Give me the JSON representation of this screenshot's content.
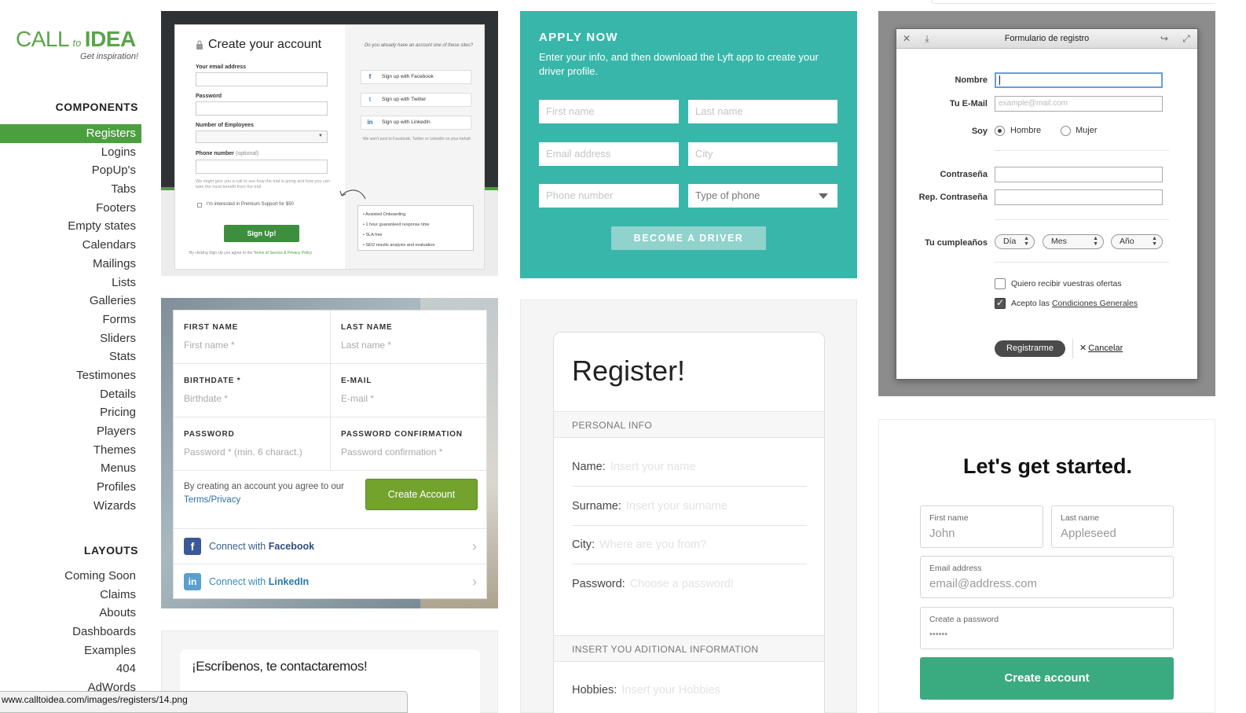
{
  "sidebar": {
    "logo": {
      "call": "CALL",
      "to": "to",
      "idea": "IDEA",
      "tagline": "Get inspiration!"
    },
    "components_title": "COMPONENTS",
    "components": [
      "Registers",
      "Logins",
      "PopUp's",
      "Tabs",
      "Footers",
      "Empty states",
      "Calendars",
      "Mailings",
      "Lists",
      "Galleries",
      "Forms",
      "Sliders",
      "Stats",
      "Testimones",
      "Details",
      "Pricing",
      "Players",
      "Themes",
      "Menus",
      "Profiles",
      "Wizards"
    ],
    "layouts_title": "LAYOUTS",
    "layouts": [
      "Coming Soon",
      "Claims",
      "Abouts",
      "Dashboards",
      "Examples",
      "404",
      "AdWords"
    ]
  },
  "statusbar": {
    "url": "www.calltoidea.com/images/registers/14.png"
  },
  "card1": {
    "title": "Create your account",
    "email_label": "Your email address",
    "password_label": "Password",
    "employees_label": "Number of Employees",
    "phone_label": "Phone number",
    "phone_optional": "(optional)",
    "phone_note": "We might give you a call to see how the trial is going and how you can take the most benefit from the trial",
    "premium_label": "I'm interested in Premium Support for $50",
    "signup_button": "Sign Up!",
    "terms_prefix": "By clicking Sign Up you agree to the",
    "terms_link": "Terms of Service & Privacy Policy",
    "already": "Do you already have an account one of these sites?",
    "social": [
      {
        "label": "Sign up with Facebook",
        "icon": "f",
        "color": "#3b5998"
      },
      {
        "label": "Sign up with Twitter",
        "icon": "t",
        "color": "#4aa3df"
      },
      {
        "label": "Sign up with LinkedIn",
        "icon": "in",
        "color": "#2a6fa8"
      }
    ],
    "social_note": "We won't post to Facebook, Twitter or LinkedIn on your behalf.",
    "benefits": [
      "Assisted Onboarding",
      "1 hour guaranteed response time",
      "SLA free",
      "SEO results analysis and evaluation"
    ]
  },
  "card2": {
    "title": "APPLY NOW",
    "description": "Enter your info, and then download the Lyft app to create your driver profile.",
    "first_name": "First name",
    "last_name": "Last name",
    "email": "Email address",
    "city": "City",
    "phone": "Phone number",
    "phone_type": "Type of phone",
    "button": "BECOME A DRIVER"
  },
  "card3": {
    "window_title": "Formulario de registro",
    "nombre_label": "Nombre",
    "email_label": "Tu E-Mail",
    "email_placeholder": "example@mail.com",
    "soy_label": "Soy",
    "hombre": "Hombre",
    "mujer": "Mujer",
    "password_label": "Contraseña",
    "password_repeat_label": "Rep. Contraseña",
    "birthday_label": "Tu cumpleaños",
    "day": "Día",
    "month": "Mes",
    "year": "Año",
    "offers_label": "Quiero recibir vuestras ofertas",
    "accept_prefix": "Acepto las",
    "accept_link": "Condiciones Generales",
    "register_button": "Registrarme",
    "cancel": "Cancelar"
  },
  "card4": {
    "fields": [
      {
        "label": "FIRST NAME",
        "placeholder": "First name *"
      },
      {
        "label": "LAST NAME",
        "placeholder": "Last name *"
      },
      {
        "label": "BIRTHDATE *",
        "placeholder": "Birthdate *"
      },
      {
        "label": "E-MAIL",
        "placeholder": "E-mail *"
      },
      {
        "label": "PASSWORD",
        "placeholder": "Password * (min. 6 charact.)"
      },
      {
        "label": "PASSWORD CONFIRMATION",
        "placeholder": "Password confirmation *"
      }
    ],
    "agree_prefix": "By creating an account you agree to our",
    "agree_link": "Terms/Privacy",
    "create_button": "Create Account",
    "facebook_prefix": "Connect with",
    "facebook_brand": "Facebook",
    "linkedin_prefix": "Connect with",
    "linkedin_brand": "LinkedIn"
  },
  "card5": {
    "title": "Register!",
    "personal_info": "PERSONAL INFO",
    "rows": [
      {
        "label": "Name:",
        "placeholder": "Insert your name"
      },
      {
        "label": "Surname:",
        "placeholder": "Insert your surname"
      },
      {
        "label": "City:",
        "placeholder": "Where are you from?"
      },
      {
        "label": "Password:",
        "placeholder": "Choose a password!"
      }
    ],
    "additional_info": "INSERT YOU ADITIONAL INFORMATION",
    "hobbies_label": "Hobbies:",
    "hobbies_placeholder": "Insert your Hobbies"
  },
  "card6": {
    "title": "Let's get started.",
    "first_name_label": "First name",
    "first_name_value": "John",
    "last_name_label": "Last name",
    "last_name_value": "Appleseed",
    "email_label": "Email address",
    "email_value": "email@address.com",
    "password_label": "Create a password",
    "password_value": "••••••",
    "button": "Create account"
  },
  "card7": {
    "title": "¡Escríbenos, te contactaremos!"
  }
}
